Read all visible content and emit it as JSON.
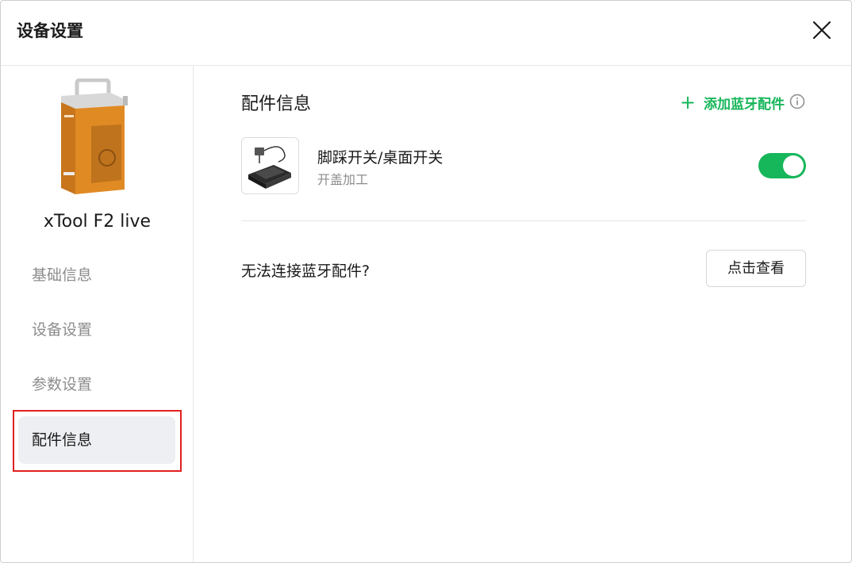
{
  "window": {
    "title": "设备设置",
    "close_icon": "close-icon"
  },
  "sidebar": {
    "device_name": "xTool F2 live",
    "items": [
      {
        "label": "基础信息",
        "active": false
      },
      {
        "label": "设备设置",
        "active": false
      },
      {
        "label": "参数设置",
        "active": false
      },
      {
        "label": "配件信息",
        "active": true
      }
    ]
  },
  "main": {
    "section_title": "配件信息",
    "add_button": {
      "icon": "plus-icon",
      "label": "添加蓝牙配件"
    },
    "info_icon": "info-icon",
    "accessory": {
      "name": "脚踩开关/桌面开关",
      "subtitle": "开盖加工",
      "enabled": true
    },
    "help": {
      "text": "无法连接蓝牙配件?",
      "button_label": "点击查看"
    }
  },
  "colors": {
    "accent": "#16b65a",
    "highlight": "#e02020",
    "active_bg": "#eeeff2"
  }
}
